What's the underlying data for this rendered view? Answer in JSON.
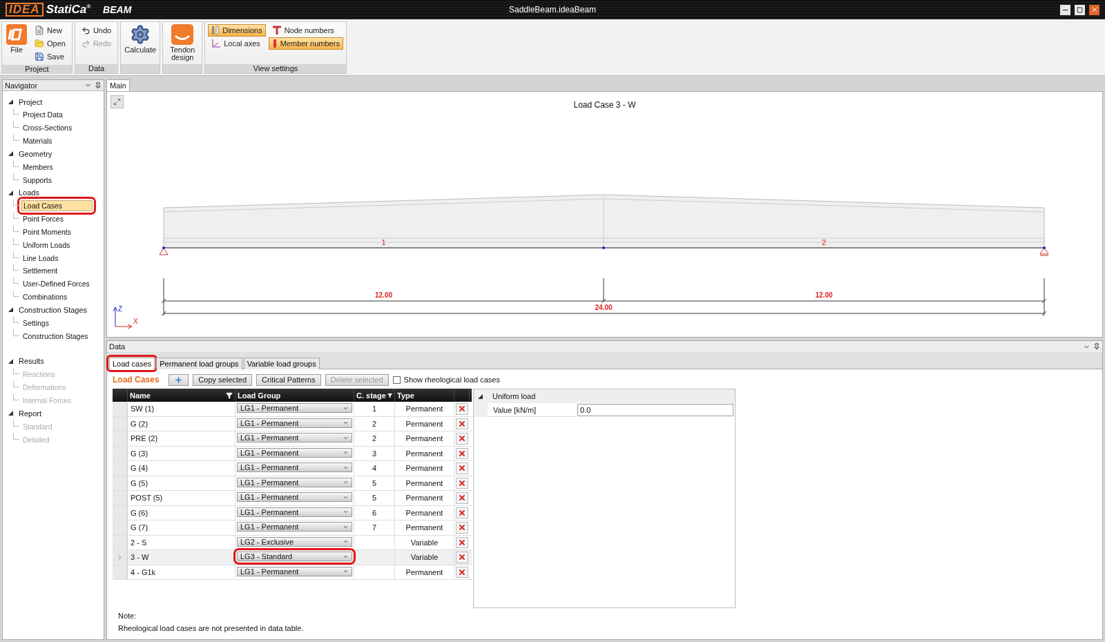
{
  "window": {
    "logo": "IDEA",
    "brand": "StatiCa$^{®}$",
    "product": "BEAM",
    "title": "SaddleBeam.ideaBeam"
  },
  "ribbon": [
    {
      "label": "Project",
      "items": [
        {
          "kind": "big",
          "label": "File"
        },
        {
          "kind": "small",
          "label": "New",
          "disabled": false
        },
        {
          "kind": "small",
          "label": "Open",
          "disabled": false
        },
        {
          "kind": "small",
          "label": "Save",
          "disabled": false
        }
      ]
    },
    {
      "label": "Data",
      "items": [
        {
          "kind": "small",
          "label": "Undo",
          "disabled": false
        },
        {
          "kind": "small",
          "label": "Redo",
          "disabled": true
        }
      ]
    },
    {
      "items": [
        {
          "kind": "big",
          "label": "Calculate"
        }
      ]
    },
    {
      "items": [
        {
          "kind": "big",
          "label": "Tendon design"
        }
      ]
    },
    {
      "label": "View settings",
      "items": [
        {
          "kind": "toggle",
          "label": "Dimensions",
          "on": true
        },
        {
          "kind": "toggle",
          "label": "Local axes",
          "on": false
        },
        {
          "kind": "toggle",
          "label": "Node numbers",
          "on": false
        },
        {
          "kind": "toggle",
          "label": "Member numbers",
          "on": true
        }
      ]
    }
  ],
  "navigator": {
    "title": "Navigator",
    "items": [
      {
        "label": "Project",
        "expanded": true,
        "children": [
          {
            "label": "Project Data",
            "disabled": false,
            "selected": false
          },
          {
            "label": "Cross-Sections",
            "disabled": false,
            "selected": false
          },
          {
            "label": "Materials",
            "disabled": false,
            "selected": false
          }
        ]
      },
      {
        "label": "Geometry",
        "expanded": true,
        "children": [
          {
            "label": "Members",
            "disabled": false,
            "selected": false
          },
          {
            "label": "Supports",
            "disabled": false,
            "selected": false
          }
        ]
      },
      {
        "label": "Loads",
        "expanded": true,
        "children": [
          {
            "label": "Load Cases",
            "disabled": false,
            "selected": true,
            "highlighted": true
          },
          {
            "label": "Point Forces",
            "disabled": false,
            "selected": false
          },
          {
            "label": "Point Moments",
            "disabled": false,
            "selected": false
          },
          {
            "label": "Uniform Loads",
            "disabled": false,
            "selected": false
          },
          {
            "label": "Line Loads",
            "disabled": false,
            "selected": false
          },
          {
            "label": "Settlement",
            "disabled": false,
            "selected": false
          },
          {
            "label": "User-Defined Forces",
            "disabled": false,
            "selected": false
          },
          {
            "label": "Combinations",
            "disabled": false,
            "selected": false
          }
        ]
      },
      {
        "label": "Construction Stages",
        "expanded": true,
        "children": [
          {
            "label": "Settings",
            "disabled": false,
            "selected": false
          },
          {
            "label": "Construction Stages",
            "disabled": false,
            "selected": false
          }
        ]
      },
      {
        "label": "Results",
        "expanded": true,
        "children": [
          {
            "label": "Reactions",
            "disabled": true,
            "selected": false
          },
          {
            "label": "Deformations",
            "disabled": true,
            "selected": false
          },
          {
            "label": "Internal Forces",
            "disabled": true,
            "selected": false
          }
        ]
      },
      {
        "label": "Report",
        "expanded": true,
        "children": [
          {
            "label": "Standard",
            "disabled": true,
            "selected": false
          },
          {
            "label": "Detailed",
            "disabled": true,
            "selected": false
          }
        ]
      }
    ]
  },
  "main": {
    "tab": "Main",
    "canvas_title": "Load Case 3 - W",
    "members": [
      "1",
      "2"
    ],
    "spans": [
      "12.00",
      "12.00"
    ],
    "total": "24.00",
    "axes": [
      "Z",
      "X"
    ]
  },
  "data": {
    "title": "Data",
    "tabs": [
      {
        "label": "Load cases",
        "selected": true,
        "highlighted": true
      },
      {
        "label": "Permanent load groups",
        "selected": false
      },
      {
        "label": "Variable load groups",
        "selected": false
      }
    ],
    "heading": "Load Cases",
    "buttons": [
      {
        "label": "Copy selected",
        "disabled": false
      },
      {
        "label": "Critical Patterns",
        "disabled": false
      },
      {
        "label": "Delete selected",
        "disabled": true
      }
    ],
    "rheological": {
      "label": "Show rheological load cases",
      "checked": false
    },
    "columns": [
      {
        "label": "Name",
        "filter": true
      },
      {
        "label": "Load Group",
        "filter": false
      },
      {
        "label": "C. stage",
        "filter": true
      },
      {
        "label": "Type",
        "filter": false
      }
    ],
    "rows": [
      {
        "name": "SW (1)",
        "group": "LG1 - Permanent",
        "stage": "1",
        "type": "Permanent",
        "selected": false
      },
      {
        "name": "G (2)",
        "group": "LG1 - Permanent",
        "stage": "2",
        "type": "Permanent",
        "selected": false
      },
      {
        "name": "PRE (2)",
        "group": "LG1 - Permanent",
        "stage": "2",
        "type": "Permanent",
        "selected": false
      },
      {
        "name": "G (3)",
        "group": "LG1 - Permanent",
        "stage": "3",
        "type": "Permanent",
        "selected": false
      },
      {
        "name": "G (4)",
        "group": "LG1 - Permanent",
        "stage": "4",
        "type": "Permanent",
        "selected": false
      },
      {
        "name": "G (5)",
        "group": "LG1 - Permanent",
        "stage": "5",
        "type": "Permanent",
        "selected": false
      },
      {
        "name": "POST (5)",
        "group": "LG1 - Permanent",
        "stage": "5",
        "type": "Permanent",
        "selected": false
      },
      {
        "name": "G (6)",
        "group": "LG1 - Permanent",
        "stage": "6",
        "type": "Permanent",
        "selected": false
      },
      {
        "name": "G (7)",
        "group": "LG1 - Permanent",
        "stage": "7",
        "type": "Permanent",
        "selected": false
      },
      {
        "name": "2 - S",
        "group": "LG2 - Exclusive",
        "type": "Variable",
        "selected": false
      },
      {
        "name": "3 - W",
        "group": "LG3 - Standard",
        "type": "Variable",
        "selected": true,
        "highlighted": true
      },
      {
        "name": "4 - G1k",
        "group": "LG1 - Permanent",
        "type": "Permanent",
        "selected": false
      }
    ],
    "properties": {
      "group": "Uniform load",
      "expanded": true,
      "rows": [
        {
          "label": "Value [kN/m]",
          "value": "0.0"
        }
      ]
    },
    "note": [
      "Note:",
      "Rheological load cases are not presented in data table."
    ]
  }
}
